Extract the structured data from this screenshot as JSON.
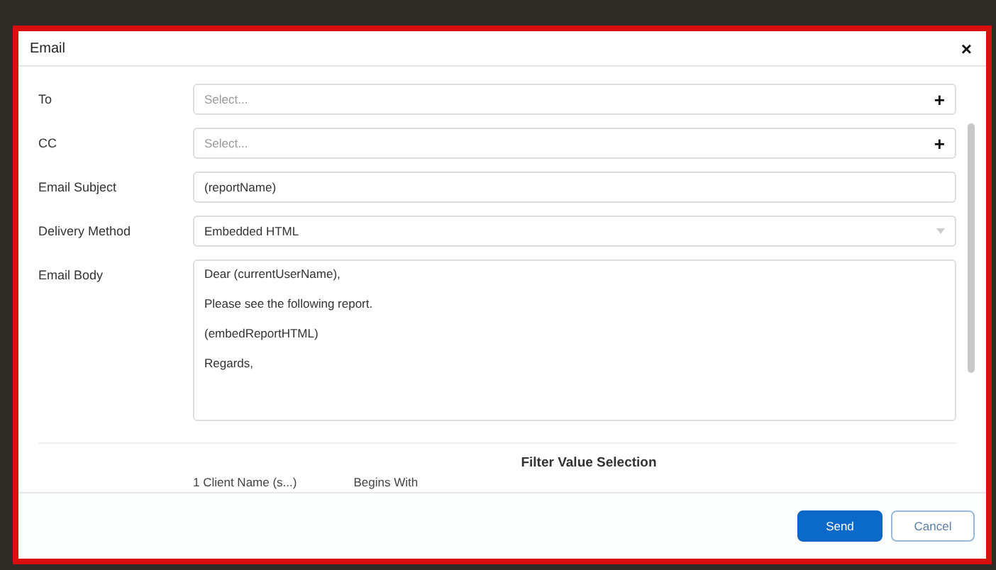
{
  "dialog": {
    "title": "Email",
    "close": "×"
  },
  "fields": [
    {
      "kind": "select",
      "label": "To",
      "placeholder": "Select...",
      "add": "+"
    },
    {
      "kind": "select",
      "label": "CC",
      "placeholder": "Select...",
      "add": "+"
    },
    {
      "kind": "text",
      "label": "Email Subject",
      "value": "(reportName)"
    },
    {
      "kind": "dropdown",
      "label": "Delivery Method",
      "value": "Embedded HTML"
    },
    {
      "kind": "body",
      "label": "Email Body",
      "lines": [
        "Dear (currentUserName),",
        "Please see the following report.",
        "(embedReportHTML)",
        "Regards,"
      ]
    }
  ],
  "filter": {
    "title": "Filter Value Selection",
    "row": [
      "1 Client Name (s...)",
      "Begins With"
    ]
  },
  "buttons": [
    {
      "label": "Send",
      "primary": true
    },
    {
      "label": "Cancel",
      "primary": false
    }
  ]
}
